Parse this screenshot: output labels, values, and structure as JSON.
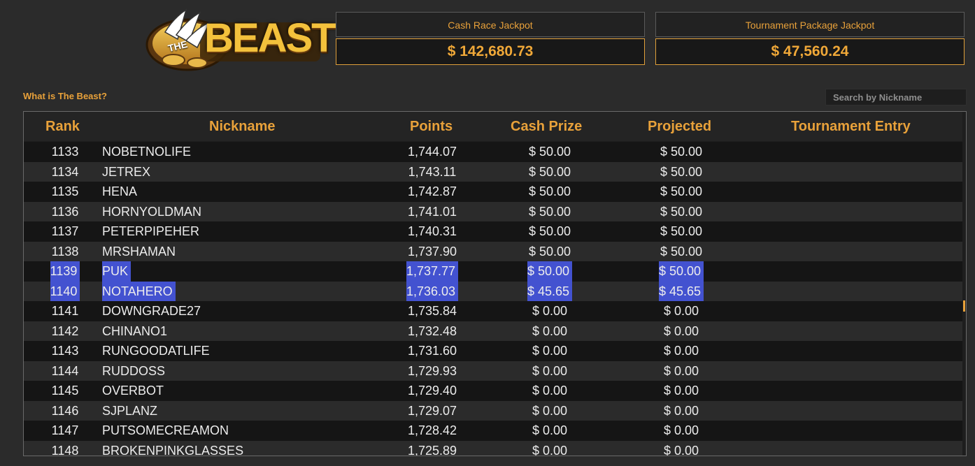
{
  "logo": {
    "the": "THE",
    "name": "BEAST"
  },
  "jackpots": {
    "cash_race": {
      "label": "Cash Race Jackpot",
      "value": "$ 142,680.73"
    },
    "tournament": {
      "label": "Tournament Package Jackpot",
      "value": "$ 47,560.24"
    }
  },
  "what_link": "What is The Beast?",
  "search": {
    "placeholder": "Search by Nickname",
    "value": ""
  },
  "table": {
    "headers": {
      "rank": "Rank",
      "nickname": "Nickname",
      "points": "Points",
      "cash": "Cash Prize",
      "projected": "Projected",
      "tournament": "Tournament Entry"
    },
    "rows": [
      {
        "rank": "1133",
        "nickname": "NOBETNOLIFE",
        "points": "1,744.07",
        "cash": "$ 50.00",
        "projected": "$ 50.00",
        "selected": false
      },
      {
        "rank": "1134",
        "nickname": "JETREX",
        "points": "1,743.11",
        "cash": "$ 50.00",
        "projected": "$ 50.00",
        "selected": false
      },
      {
        "rank": "1135",
        "nickname": "HENA",
        "points": "1,742.87",
        "cash": "$ 50.00",
        "projected": "$ 50.00",
        "selected": false
      },
      {
        "rank": "1136",
        "nickname": "HORNYOLDMAN",
        "points": "1,741.01",
        "cash": "$ 50.00",
        "projected": "$ 50.00",
        "selected": false
      },
      {
        "rank": "1137",
        "nickname": "PETERPIPEHER",
        "points": "1,740.31",
        "cash": "$ 50.00",
        "projected": "$ 50.00",
        "selected": false
      },
      {
        "rank": "1138",
        "nickname": "MRSHAMAN",
        "points": "1,737.90",
        "cash": "$ 50.00",
        "projected": "$ 50.00",
        "selected": false
      },
      {
        "rank": "1139",
        "nickname": "PUK",
        "points": "1,737.77",
        "cash": "$ 50.00",
        "projected": "$ 50.00",
        "selected": true
      },
      {
        "rank": "1140",
        "nickname": "NOTAHERO",
        "points": "1,736.03",
        "cash": "$ 45.65",
        "projected": "$ 45.65",
        "selected": true
      },
      {
        "rank": "1141",
        "nickname": "DOWNGRADE27",
        "points": "1,735.84",
        "cash": "$ 0.00",
        "projected": "$ 0.00",
        "selected": false
      },
      {
        "rank": "1142",
        "nickname": "CHINANO1",
        "points": "1,732.48",
        "cash": "$ 0.00",
        "projected": "$ 0.00",
        "selected": false
      },
      {
        "rank": "1143",
        "nickname": "RUNGOODATLIFE",
        "points": "1,731.60",
        "cash": "$ 0.00",
        "projected": "$ 0.00",
        "selected": false
      },
      {
        "rank": "1144",
        "nickname": "RUDDOSS",
        "points": "1,729.93",
        "cash": "$ 0.00",
        "projected": "$ 0.00",
        "selected": false
      },
      {
        "rank": "1145",
        "nickname": "OVERBOT",
        "points": "1,729.40",
        "cash": "$ 0.00",
        "projected": "$ 0.00",
        "selected": false
      },
      {
        "rank": "1146",
        "nickname": "SJPLANZ",
        "points": "1,729.07",
        "cash": "$ 0.00",
        "projected": "$ 0.00",
        "selected": false
      },
      {
        "rank": "1147",
        "nickname": "PUTSOMECREAMON",
        "points": "1,728.42",
        "cash": "$ 0.00",
        "projected": "$ 0.00",
        "selected": false
      },
      {
        "rank": "1148",
        "nickname": "BROKENPINKGLASSES",
        "points": "1,725.89",
        "cash": "$ 0.00",
        "projected": "$ 0.00",
        "selected": false
      }
    ]
  },
  "colors": {
    "accent": "#e8a13a",
    "selection": "#4352d0",
    "background": "#2b2b2b"
  }
}
